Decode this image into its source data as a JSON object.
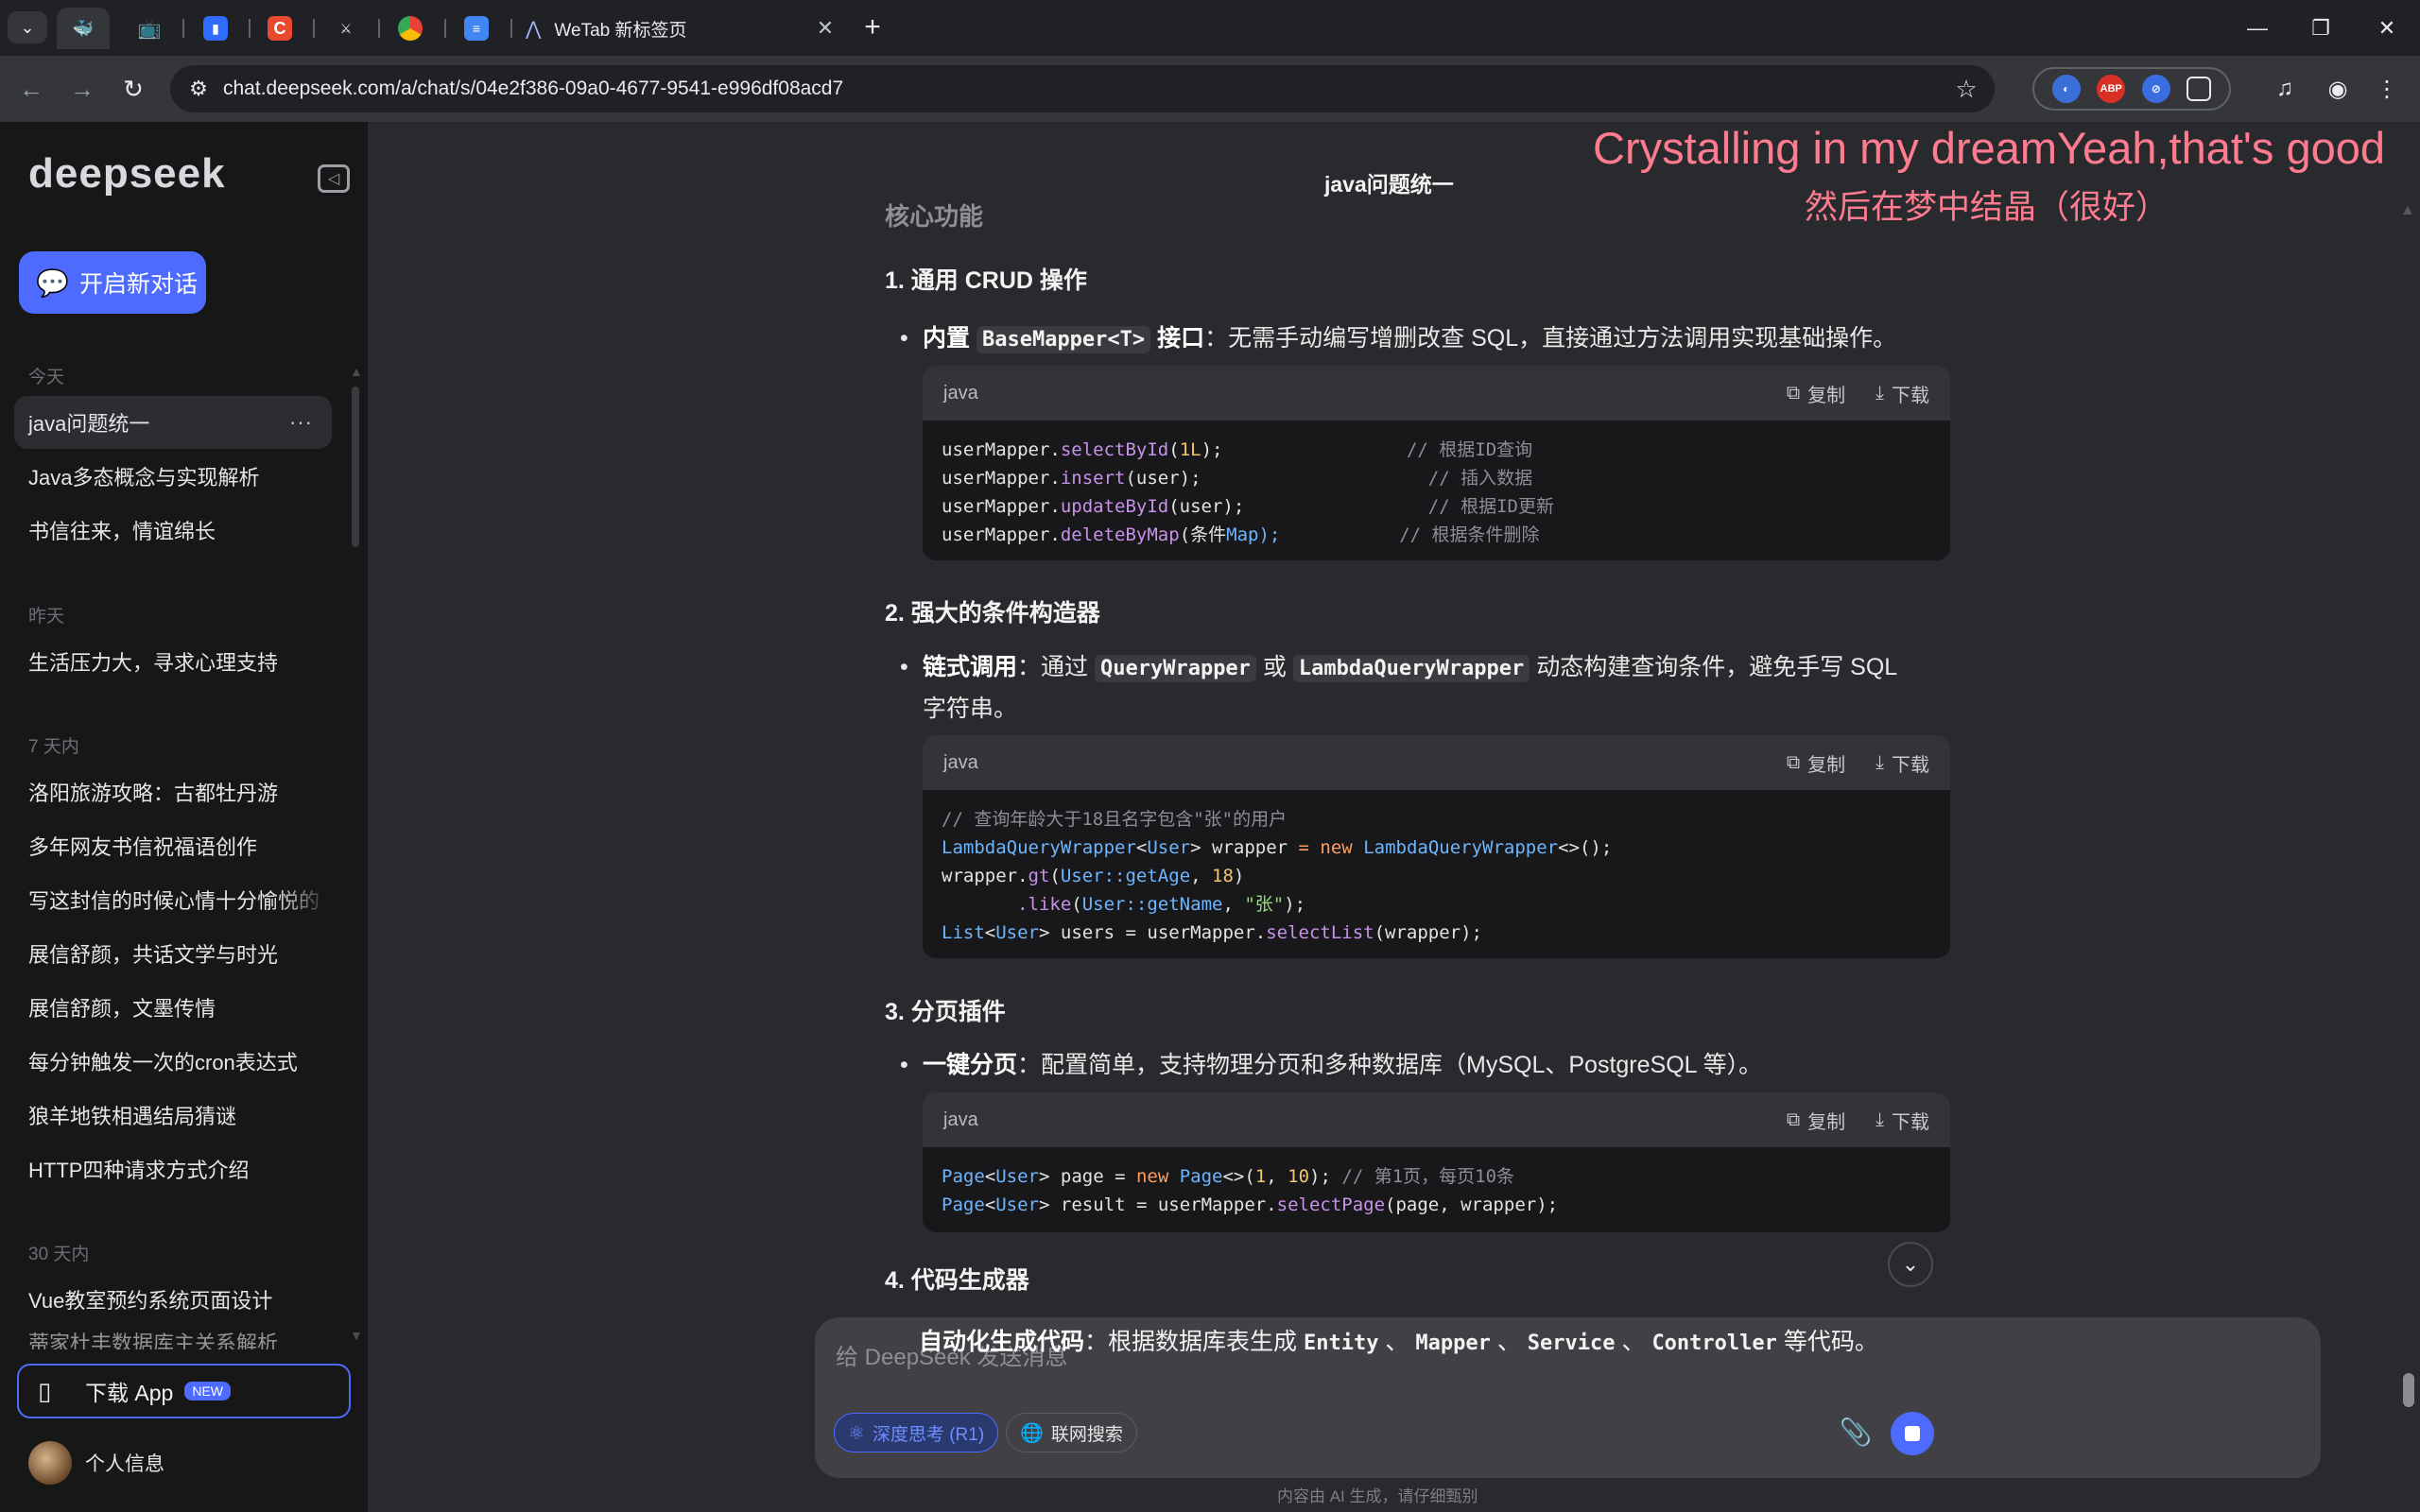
{
  "browser": {
    "tabs": [
      {
        "icon": "deepseek-icon",
        "active": true
      },
      {
        "icon": "bilibili-icon"
      },
      {
        "icon": "bookmark-icon"
      },
      {
        "icon": "c-icon"
      },
      {
        "icon": "sword-icon"
      },
      {
        "icon": "chrome-icon"
      },
      {
        "icon": "docs-icon"
      }
    ],
    "wetab_label": "WeTab 新标签页",
    "url": "chat.deepseek.com/a/chat/s/04e2f386-09a0-4677-9541-e996df08acd7",
    "extensions": [
      "ABP"
    ]
  },
  "sidebar": {
    "logo": "deepseek",
    "new_chat_label": "开启新对话",
    "groups": [
      {
        "label": "今天",
        "items": [
          "java问题统一",
          "Java多态概念与实现解析",
          "书信往来，情谊绵长"
        ]
      },
      {
        "label": "昨天",
        "items": [
          "生活压力大，寻求心理支持"
        ]
      },
      {
        "label": "7 天内",
        "items": [
          "洛阳旅游攻略：古都牡丹游",
          "多年网友书信祝福语创作",
          "写这封信的时候心情十分愉悦的",
          "展信舒颜，共话文学与时光",
          "展信舒颜，文墨传情",
          "每分钟触发一次的cron表达式",
          "狼羊地铁相遇结局猜谜",
          "HTTP四种请求方式介绍"
        ]
      },
      {
        "label": "30 天内",
        "items": [
          "Vue教室预约系统页面设计",
          "蒂家杜丰数据库主关系解析"
        ]
      }
    ],
    "active_more": "···",
    "download_app_label": "下载 App",
    "download_app_badge": "NEW",
    "profile_label": "个人信息"
  },
  "main": {
    "chat_title": "java问题统一",
    "lyric_en": "Crystalling in my dreamYeah,that's good",
    "lyric_zh": "然后在梦中结晶（很好）",
    "heading_core": "核心功能",
    "sections": [
      {
        "title": "1. 通用 CRUD 操作",
        "bullet_bold": "内置",
        "bullet_code": "BaseMapper<T>",
        "bullet_bold2": "接口",
        "bullet_text": "：无需手动编写增删改查 SQL，直接通过方法调用实现基础操作。"
      },
      {
        "title": "2. 强大的条件构造器",
        "bullet_bold": "链式调用",
        "bullet_text_a": "：通过",
        "bullet_code_a": "QueryWrapper",
        "bullet_text_b": "或",
        "bullet_code_b": "LambdaQueryWrapper",
        "bullet_text_c": "动态构建查询条件，避免手写 SQL 字符串。"
      },
      {
        "title": "3. 分页插件",
        "bullet_bold": "一键分页",
        "bullet_text": "：配置简单，支持物理分页和多种数据库（MySQL、PostgreSQL 等）。"
      },
      {
        "title": "4. 代码生成器",
        "bullet_bold": "自动化生成代码",
        "bullet_text": "：根据数据库表生成",
        "codes": [
          "Entity",
          "Mapper",
          "Service",
          "Controller"
        ],
        "sep": "、",
        "tail": "等代码。"
      }
    ],
    "code_header": {
      "lang": "java",
      "copy": "复制",
      "download": "下载"
    },
    "code1": [
      {
        "obj": "userMapper.",
        "fn": "selectById",
        "args_a": "(",
        "num": "1L",
        "args_b": ");",
        "pad": "                 ",
        "comment": "// 根据ID查询"
      },
      {
        "obj": "userMapper.",
        "fn": "insert",
        "args_a": "(user);",
        "num": "",
        "args_b": "",
        "pad": "                     ",
        "comment": "// 插入数据"
      },
      {
        "obj": "userMapper.",
        "fn": "updateById",
        "args_a": "(user);",
        "num": "",
        "args_b": "",
        "pad": "                 ",
        "comment": "// 根据ID更新"
      },
      {
        "obj": "userMapper.",
        "fn": "deleteByMap",
        "args_a": "(条件",
        "num": "",
        "args_b": "Map);",
        "pad": "           ",
        "comment": "// 根据条件删除"
      }
    ],
    "code2": {
      "comment": "// 查询年龄大于18且名字包含\"张\"的用户",
      "l2_type": "LambdaQueryWrapper",
      "l2_gen": "User",
      "l2_var": " wrapper ",
      "l2_eq": "=",
      "l2_new": " new ",
      "l2_ctor": "LambdaQueryWrapper",
      "l2_end": "<>();",
      "l3_a": "wrapper.",
      "l3_fn": "gt",
      "l3_ref": "User::getAge",
      "l3_num": "18",
      "l4_fn": ".like",
      "l4_ref": "User::getName",
      "l4_str": "\"张\"",
      "l5_type": "List",
      "l5_gen": "User",
      "l5_mid": " users = userMapper.",
      "l5_fn": "selectList",
      "l5_end": "(wrapper);"
    },
    "code3": {
      "l1_type": "Page",
      "l1_gen": "User",
      "l1_var": " page = ",
      "l1_new": "new",
      "l1_ctor": " Page",
      "l1_a": "<>(",
      "l1_n1": "1",
      "l1_n2": "10",
      "l1_comment": "// 第1页，每页10条",
      "l2_type": "Page",
      "l2_gen": "User",
      "l2_mid": " result = userMapper.",
      "l2_fn": "selectPage",
      "l2_end": "(page, wrapper);"
    },
    "input_placeholder": "给 DeepSeek 发送消息",
    "deep_think_label": "深度思考 (R1)",
    "web_search_label": "联网搜索",
    "disclaimer": "内容由 AI 生成，请仔细甄别"
  }
}
